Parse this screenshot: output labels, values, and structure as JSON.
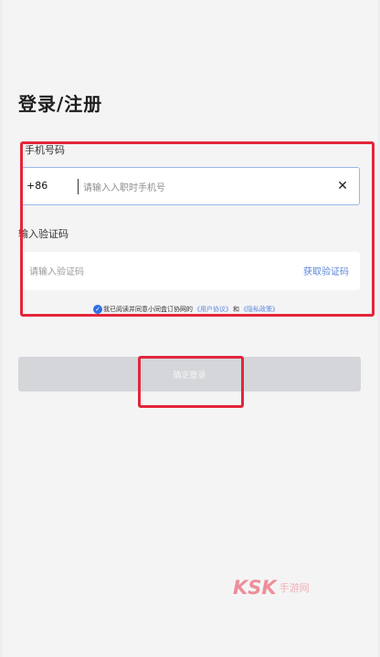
{
  "page": {
    "title": "登录/注册"
  },
  "phone": {
    "label": "手机号码",
    "prefix": "+86",
    "placeholder": "请输入入职时手机号",
    "clear_icon": "✕"
  },
  "code": {
    "label": "输入验证码",
    "placeholder": "请输入验证码",
    "get_code_label": "获取验证码"
  },
  "agreement": {
    "check_icon": "✓",
    "prefix_text": "我已阅读并同意小同盒订协网的",
    "user_agreement": "《用户协议》",
    "and_text": "和",
    "privacy_policy": "《隐私政策》"
  },
  "submit": {
    "label": "确定登录"
  },
  "watermark": {
    "logo": "KSK",
    "text": "手游网"
  },
  "colors": {
    "annotation": "#e3263b",
    "accent": "#5b86d8",
    "button_disabled": "#d4d6da"
  }
}
